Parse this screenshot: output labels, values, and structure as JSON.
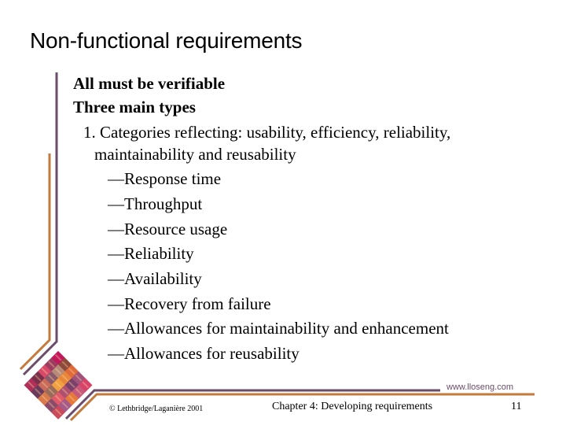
{
  "slide": {
    "title": "Non-functional requirements",
    "bullets": [
      {
        "text": "All must be verifiable",
        "bold": true
      },
      {
        "text": "Three main types",
        "bold": true
      },
      {
        "text": "1. Categories reflecting: usability, efficiency, reliability,",
        "bold": false
      },
      {
        "text": "maintainability and reusability",
        "bold": false
      },
      {
        "text": "—Response time",
        "bold": false
      },
      {
        "text": "—Throughput",
        "bold": false
      },
      {
        "text": "—Resource usage",
        "bold": false
      },
      {
        "text": "—Reliability",
        "bold": false
      },
      {
        "text": "—Availability",
        "bold": false
      },
      {
        "text": "—Recovery from failure",
        "bold": false
      },
      {
        "text": "—Allowances for maintainability and enhancement",
        "bold": false
      },
      {
        "text": "—Allowances for reusability",
        "bold": false
      }
    ]
  },
  "footer": {
    "copyright": "© Lethbridge/Laganière 2001",
    "chapter": "Chapter 4: Developing requirements",
    "page_number": "11",
    "url": "www.lloseng.com"
  },
  "theme": {
    "purple": "#6b4c6b",
    "orange": "#c47a3a"
  },
  "decor": {
    "patchwork_icon": "patchwork-diamond-logo"
  }
}
